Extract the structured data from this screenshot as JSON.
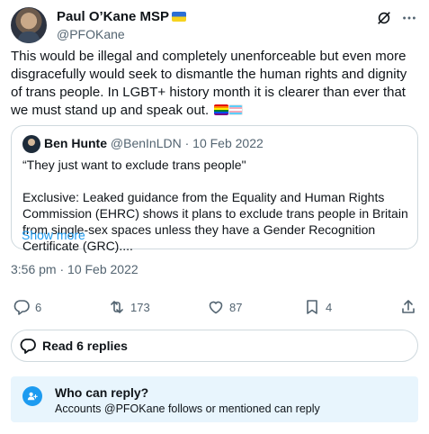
{
  "tweet": {
    "author": {
      "name": "Paul O’Kane MSP",
      "handle": "@PFOKane"
    },
    "text": "This would be illegal and completely unenforceable but even more disgracefully would seek to dismantle the human rights and dignity of trans people. In LGBT+ history month it is clearer than ever that we must stand up and speak out.",
    "emoji": [
      "rainbow-flag",
      "transgender-flag"
    ],
    "quoted": {
      "author": {
        "name": "Ben Hunte",
        "handle": "@BenInLDN",
        "separator": "·",
        "date": "10 Feb 2022"
      },
      "text": "“They just want to exclude trans people\"\n\nExclusive: Leaked guidance from the Equality and Human Rights Commission (EHRC) shows it plans to exclude trans people in Britain from single-sex spaces unless they have a Gender Recognition Certificate (GRC)....",
      "show_more": "Show more"
    },
    "timestamp": "3:56 pm · 10 Feb 2022",
    "actions": {
      "replies": "6",
      "reposts": "173",
      "likes": "87",
      "bookmarks": "4"
    }
  },
  "read_replies": {
    "label": "Read 6 replies"
  },
  "who_can_reply": {
    "title": "Who can reply?",
    "description": "Accounts @PFOKane follows or mentioned can reply"
  },
  "colors": {
    "accent": "#1d9bf0",
    "muted": "#536471",
    "panel": "#e8f5fd",
    "border": "#cfd9de"
  }
}
